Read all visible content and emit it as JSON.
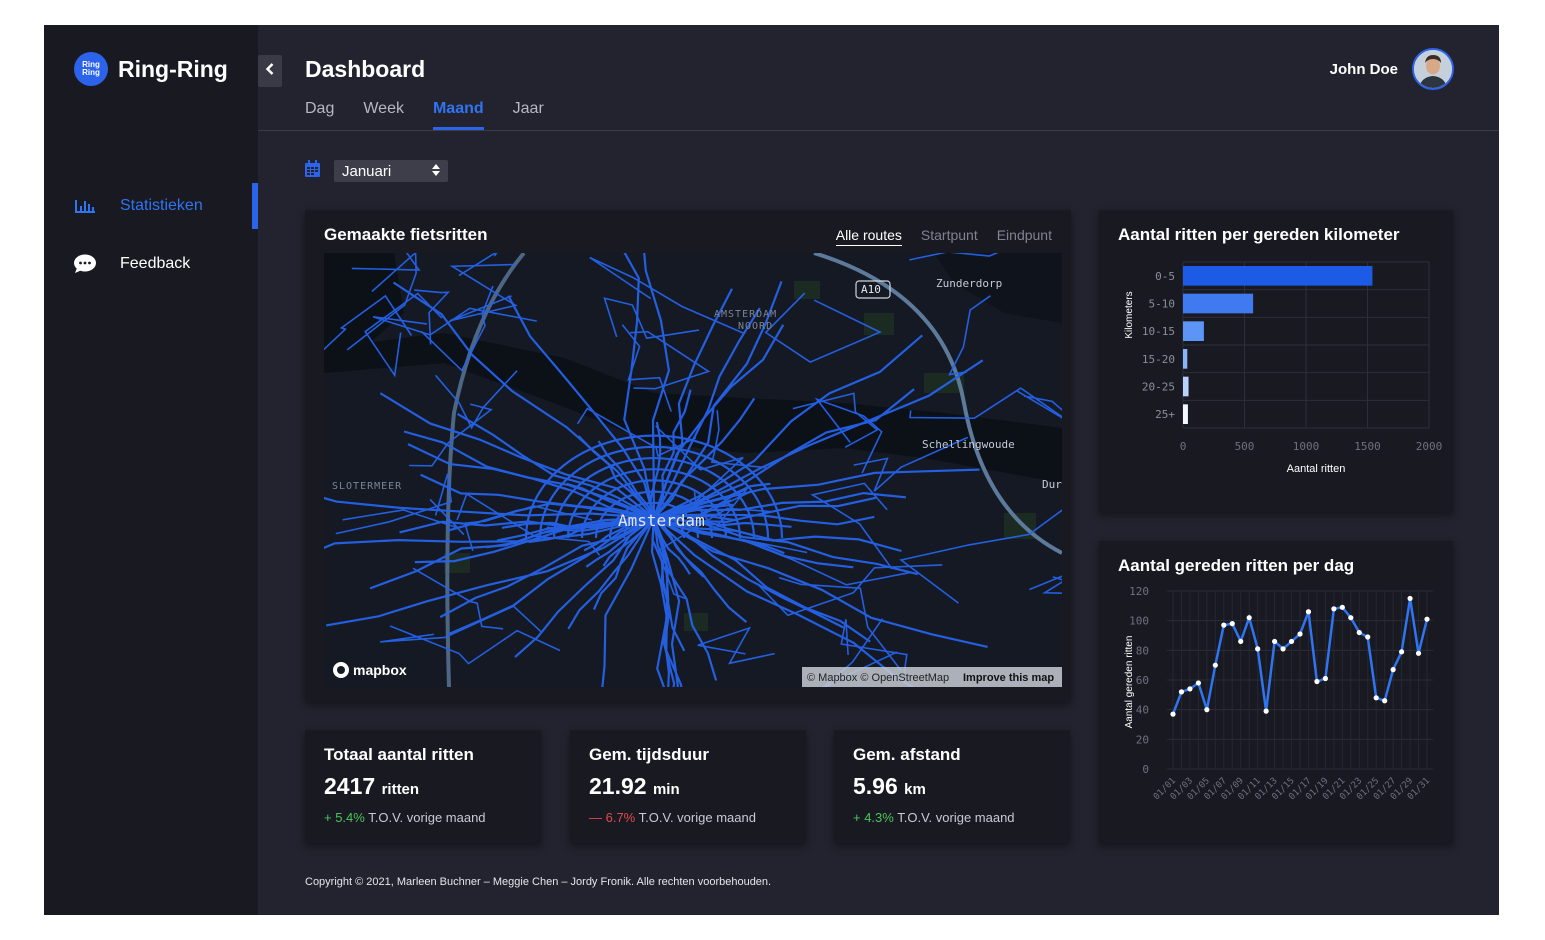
{
  "app": {
    "name": "Ring-Ring",
    "logo_text": [
      "Ring",
      "Ring"
    ]
  },
  "sidebar": {
    "items": [
      {
        "label": "Statistieken",
        "icon": "bar-chart-icon",
        "active": true
      },
      {
        "label": "Feedback",
        "icon": "speech-bubble-icon",
        "active": false
      }
    ]
  },
  "header": {
    "title": "Dashboard",
    "tabs": [
      {
        "label": "Dag",
        "active": false
      },
      {
        "label": "Week",
        "active": false
      },
      {
        "label": "Maand",
        "active": true
      },
      {
        "label": "Jaar",
        "active": false
      }
    ],
    "user_name": "John Doe"
  },
  "filter": {
    "month": "Januari",
    "icon": "calendar-icon"
  },
  "map_card": {
    "title": "Gemaakte fietsritten",
    "tabs": [
      "Alle routes",
      "Startpunt",
      "Eindpunt"
    ],
    "active_tab": "Alle routes",
    "labels": [
      "A10",
      "Zunderdorp",
      "AMSTERDAM",
      "NOORD",
      "Schellingwoude",
      "Amsterdam",
      "SLOTERMEER",
      "Dur"
    ],
    "attribution": "© Mapbox © OpenStreetMap",
    "improve": "Improve this map",
    "brand": "mapbox"
  },
  "stats": [
    {
      "title": "Totaal aantal ritten",
      "value": "2417",
      "unit": "ritten",
      "change": "+ 5.4%",
      "change_dir": "up",
      "suffix": "T.O.V. vorige maand"
    },
    {
      "title": "Gem. tijdsduur",
      "value": "21.92",
      "unit": "min",
      "change": "— 6.7%",
      "change_dir": "down",
      "suffix": "T.O.V. vorige maand"
    },
    {
      "title": "Gem. afstand",
      "value": "5.96",
      "unit": "km",
      "change": "+ 4.3%",
      "change_dir": "up",
      "suffix": "T.O.V. vorige maand"
    }
  ],
  "chart_km_title": "Aantal ritten per gereden kilometer",
  "chart_day_title": "Aantal gereden ritten per dag",
  "chart_data": [
    {
      "type": "bar",
      "orientation": "horizontal",
      "title": "Aantal ritten per gereden kilometer",
      "categories": [
        "0-5",
        "5-10",
        "10-15",
        "15-20",
        "20-25",
        "25+"
      ],
      "values": [
        1540,
        570,
        170,
        35,
        45,
        40
      ],
      "colors": [
        "#1c5be6",
        "#3f7af0",
        "#5c95f5",
        "#8ab4f8",
        "#b9d2fb",
        "#f3f7ff"
      ],
      "xlabel": "Aantal ritten",
      "ylabel": "Kilometers",
      "xlim": [
        0,
        2000
      ],
      "xticks": [
        "0",
        "500",
        "1000",
        "1500",
        "2000"
      ],
      "grid": true
    },
    {
      "type": "line",
      "title": "Aantal gereden ritten per dag",
      "x": [
        "01/01",
        "01/02",
        "01/03",
        "01/04",
        "01/05",
        "01/06",
        "01/07",
        "01/08",
        "01/09",
        "01/10",
        "01/11",
        "01/12",
        "01/13",
        "01/14",
        "01/15",
        "01/16",
        "01/17",
        "01/18",
        "01/19",
        "01/20",
        "01/21",
        "01/22",
        "01/23",
        "01/24",
        "01/25",
        "01/26",
        "01/27",
        "01/28",
        "01/29",
        "01/30",
        "01/31"
      ],
      "xticks": [
        "01/01",
        "01/03",
        "01/05",
        "01/07",
        "01/09",
        "01/11",
        "01/13",
        "01/15",
        "01/17",
        "01/19",
        "01/21",
        "01/23",
        "01/25",
        "01/27",
        "01/29",
        "01/31"
      ],
      "values": [
        37,
        52,
        54,
        58,
        40,
        70,
        97,
        98,
        86,
        102,
        81,
        39,
        86,
        81,
        86,
        91,
        106,
        59,
        61,
        108,
        109,
        102,
        92,
        89,
        48,
        46,
        67,
        79,
        115,
        78,
        101
      ],
      "ylabel": "Aantal gereden ritten",
      "ylim": [
        0,
        120
      ],
      "yticks": [
        "0",
        "20",
        "40",
        "60",
        "80",
        "100",
        "120"
      ],
      "color": "#2f74f0",
      "grid": true
    }
  ],
  "footer": "Copyright © 2021, Marleen Buchner – Meggie Chen – Jordy Fronik. Alle rechten voorbehouden."
}
